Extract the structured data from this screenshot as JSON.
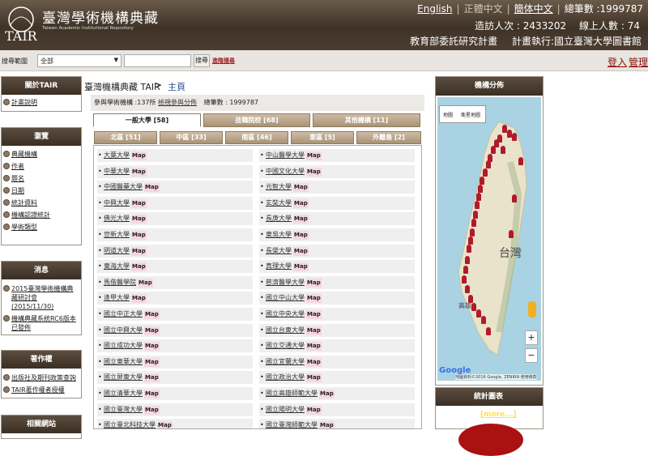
{
  "header": {
    "logo_letters": "TAIR",
    "site_title": "臺灣學術機構典藏",
    "site_subtitle": "Taiwan Academic Institutional Repository",
    "lang_english": "English",
    "lang_trad": "正體中文",
    "lang_simp": "簡体中文",
    "lang_sep": "|",
    "total_label": "總筆數 :",
    "total_value": "1999787",
    "visitors_label": "造訪人次 :",
    "visitors_value": "2433202",
    "online_label": "線上人數 :",
    "online_value": "74",
    "org_sponsor": "教育部委託研究計畫",
    "org_exec": "計畫執行:國立臺灣大學圖書館"
  },
  "search": {
    "scope_label": "搜尋範圍",
    "scope_value": "全部",
    "query_value": "",
    "button_label": "搜尋",
    "advanced_label": "進階搜尋",
    "login_label": "登入",
    "admin_label": "管理"
  },
  "sidebar": {
    "about": {
      "title": "關於TAIR",
      "items": [
        "計畫說明"
      ]
    },
    "browse": {
      "title": "瀏覽",
      "items": [
        "典藏機構",
        "作者",
        "題名",
        "日期",
        "統計資料",
        "機構認證統計",
        "學術類型"
      ]
    },
    "news": {
      "title": "消息",
      "items": [
        "2015臺灣學術機構典藏研討會(2015/11/30)",
        "機構典藏系統RC6版本已發佈"
      ]
    },
    "copyright": {
      "title": "著作權",
      "items": [
        "出版社及期刊政策查詢",
        "TAIR著作權者授權"
      ]
    },
    "links": {
      "title": "相關網站"
    }
  },
  "breadcrumb": {
    "site": "臺灣機構典藏 TAIR",
    "sep": ">",
    "home": "主頁"
  },
  "info": {
    "participants": "參與學術機構 :137所",
    "check_link": "檢視參與分佈",
    "total": "總筆數 : 1999787"
  },
  "tabs": [
    {
      "label": "一般大學 [58]",
      "active": true
    },
    {
      "label": "技職院校 [68]",
      "active": false
    },
    {
      "label": "其他機構 [11]",
      "active": false
    }
  ],
  "regions": [
    {
      "label": "北區 [51]"
    },
    {
      "label": "中區 [33]"
    },
    {
      "label": "南區 [46]"
    },
    {
      "label": "東區 [5]"
    },
    {
      "label": "外離島 [2]"
    }
  ],
  "map_label": "Map",
  "institutions_left": [
    "大葉大學",
    "中華大學",
    "中國醫藥大學",
    "中興大學",
    "佛光大學",
    "世新大學",
    "明道大學",
    "東海大學",
    "馬偕醫學院",
    "逢甲大學",
    "國立中正大學",
    "國立中興大學",
    "國立成功大學",
    "國立東華大學",
    "國立屏東大學",
    "國立清華大學",
    "國立臺灣大學",
    "國立臺北科技大學"
  ],
  "institutions_right": [
    "中山醫學大學",
    "中國文化大學",
    "元智大學",
    "玄奘大學",
    "長庚大學",
    "東吳大學",
    "長榮大學",
    "真理大學",
    "慈濟醫學大學",
    "國立中山大學",
    "國立中央大學",
    "國立台東大學",
    "國立交通大學",
    "國立宜蘭大學",
    "國立政治大學",
    "國立高雄師範大學",
    "國立陽明大學",
    "國立臺灣師範大學"
  ],
  "map_panel": {
    "title": "機構分佈",
    "map_type_map": "地圖",
    "map_type_sat": "衛星地圖",
    "region_label": "台灣",
    "city_label": "高雄",
    "google_logo": "Google",
    "attribution": "地圖資料©2016 Google, ZENRIN  使用條款",
    "zoom_in": "+",
    "zoom_out": "−"
  },
  "stats_panel": {
    "title": "統計圖表",
    "more": "[more...]"
  },
  "colors": {
    "header_brown": "#3f3327",
    "tab_tan": "#a99376",
    "map_pin": "#b11a2b",
    "map_land": "#e9e3cc",
    "map_sea": "#a9d2e3"
  }
}
